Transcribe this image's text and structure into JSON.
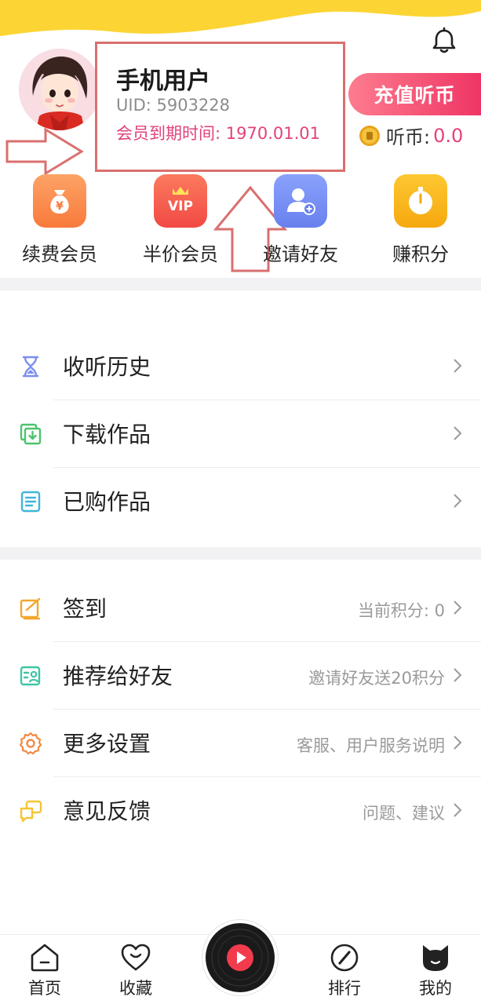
{
  "colors": {
    "accent_pink": "#e5417c",
    "recharge_gradient_start": "#fd7c8e",
    "recharge_gradient_end": "#ef3565",
    "top_wave_yellow": "#fcd535",
    "annotation_red": "#d9706f"
  },
  "header": {
    "notification_icon": "bell-icon"
  },
  "profile": {
    "avatar_icon": "avatar-girl",
    "name": "手机用户",
    "uid_text": "UID:  5903228",
    "vip_expiry_text": "会员到期时间:  1970.01.01"
  },
  "wallet": {
    "recharge_label": "充值听币",
    "coin_label": "听币:",
    "coin_value": "0.0",
    "coin_icon": "coin-icon"
  },
  "quick_actions": [
    {
      "label": "续费会员",
      "icon": "money-bag-icon",
      "color": "#fb8a4a"
    },
    {
      "label": "半价会员",
      "icon": "vip-crown-icon",
      "color": "#f6574f"
    },
    {
      "label": "邀请好友",
      "icon": "add-user-icon",
      "color": "#7189f2"
    },
    {
      "label": "赚积分",
      "icon": "stopwatch-icon",
      "color": "#f9b81a"
    }
  ],
  "menu_group_1": [
    {
      "label": "收听历史",
      "sub": "",
      "icon": "hourglass-icon"
    },
    {
      "label": "下载作品",
      "sub": "",
      "icon": "download-icon"
    },
    {
      "label": "已购作品",
      "sub": "",
      "icon": "document-icon"
    }
  ],
  "menu_group_2": [
    {
      "label": "签到",
      "sub": "当前积分:  0",
      "icon": "check-in-icon"
    },
    {
      "label": "推荐给好友",
      "sub": "邀请好友送20积分",
      "icon": "share-user-icon"
    },
    {
      "label": "更多设置",
      "sub": "客服、用户服务说明",
      "icon": "gear-icon"
    },
    {
      "label": "意见反馈",
      "sub": "问题、建议",
      "icon": "chat-bubbles-icon"
    }
  ],
  "tabbar": {
    "home": "首页",
    "favorites": "收藏",
    "player_icon": "play-icon",
    "ranking": "排行",
    "mine": "我的"
  }
}
